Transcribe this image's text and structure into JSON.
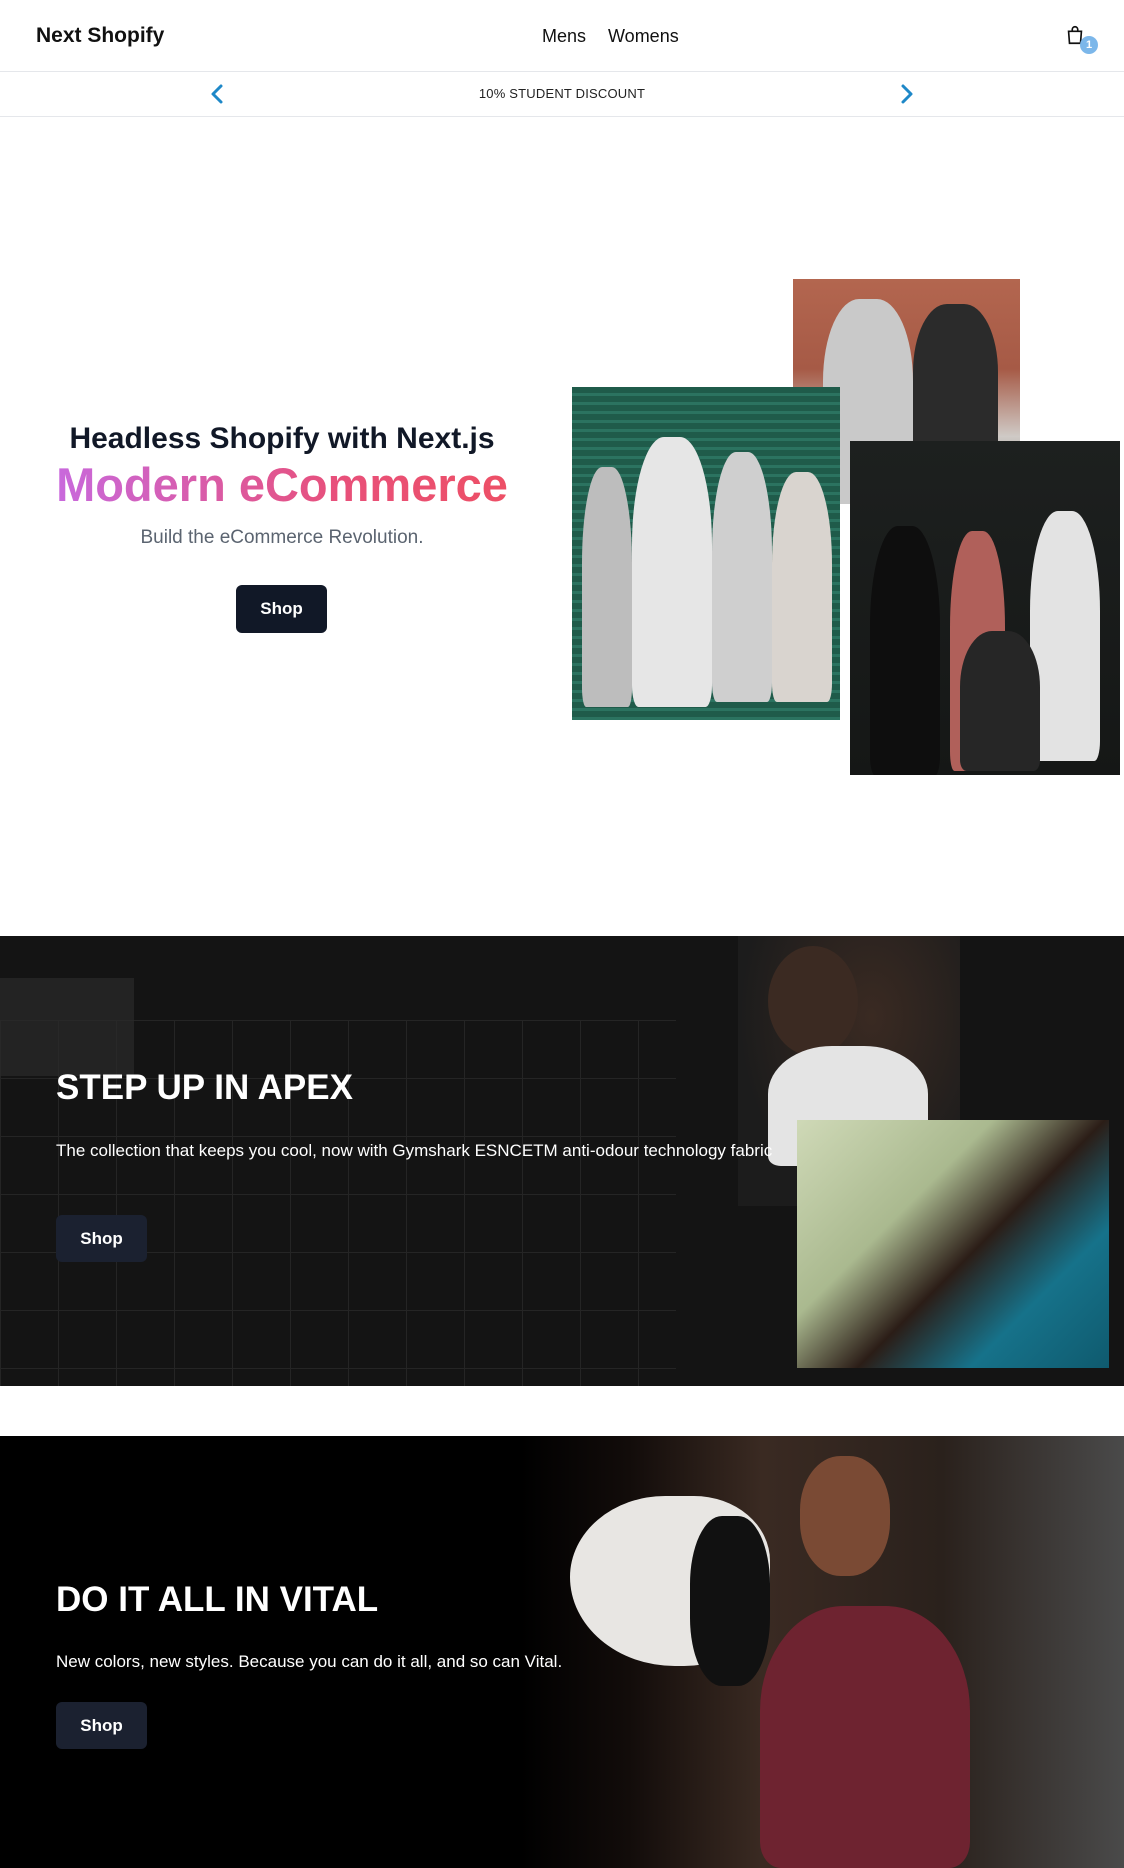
{
  "header": {
    "logo": "Next Shopify",
    "nav": [
      "Mens",
      "Womens"
    ],
    "cart_count": "1"
  },
  "announcement": {
    "text": "10% STUDENT DISCOUNT"
  },
  "hero": {
    "title": "Headless Shopify with Next.js",
    "gradient_title": "Modern eCommerce",
    "subtitle": "Build the eCommerce Revolution.",
    "button": "Shop",
    "gradient_colors": [
      "#c26ef0",
      "#e8507a",
      "#ef4f5f"
    ]
  },
  "apex": {
    "title": "STEP UP IN APEX",
    "description": "The collection that keeps you cool, now with Gymshark ESNCETM anti-odour technology fabric",
    "button": "Shop"
  },
  "vital": {
    "title": "DO IT ALL IN VITAL",
    "description": "New colors, new styles. Because you can do it all, and so can Vital.",
    "button": "Shop"
  },
  "colors": {
    "dark_button": "#111827",
    "accent_arrow": "#1e88c8",
    "cart_badge": "#7cb7ea"
  }
}
